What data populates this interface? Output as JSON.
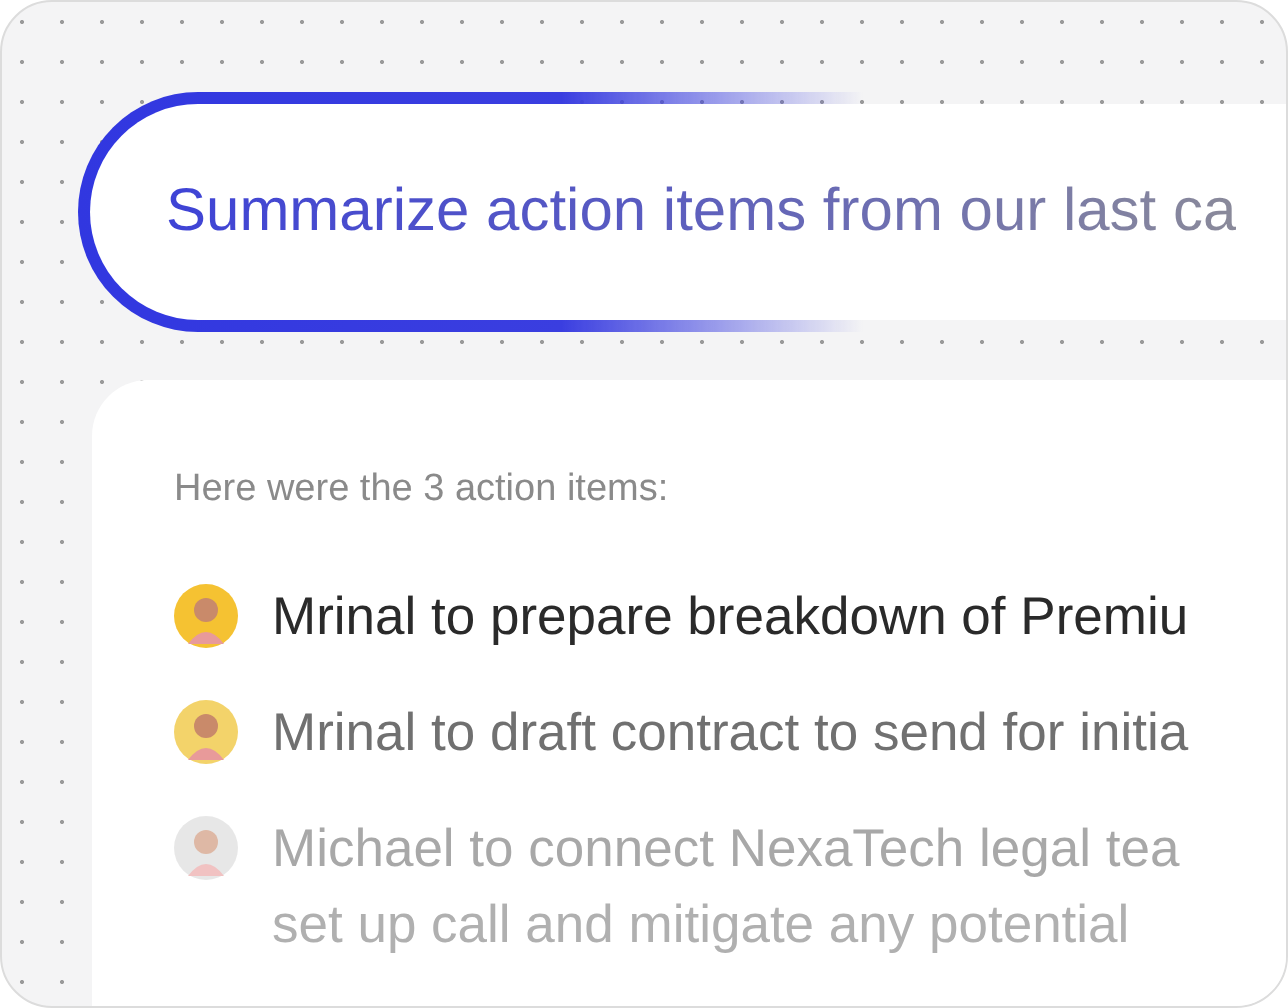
{
  "prompt": {
    "text": "Summarize action items from our last ca"
  },
  "answer": {
    "intro": "Here were the 3 action items:",
    "items": [
      {
        "kind": "sharp",
        "lines": [
          "Mrinal to prepare breakdown of Premiu"
        ]
      },
      {
        "kind": "soft",
        "lines": [
          "Mrinal to draft contract to send for initia"
        ]
      },
      {
        "kind": "blurred",
        "lines": [
          "Michael to connect NexaTech legal tea",
          "set up call and mitigate any potential"
        ]
      }
    ]
  }
}
